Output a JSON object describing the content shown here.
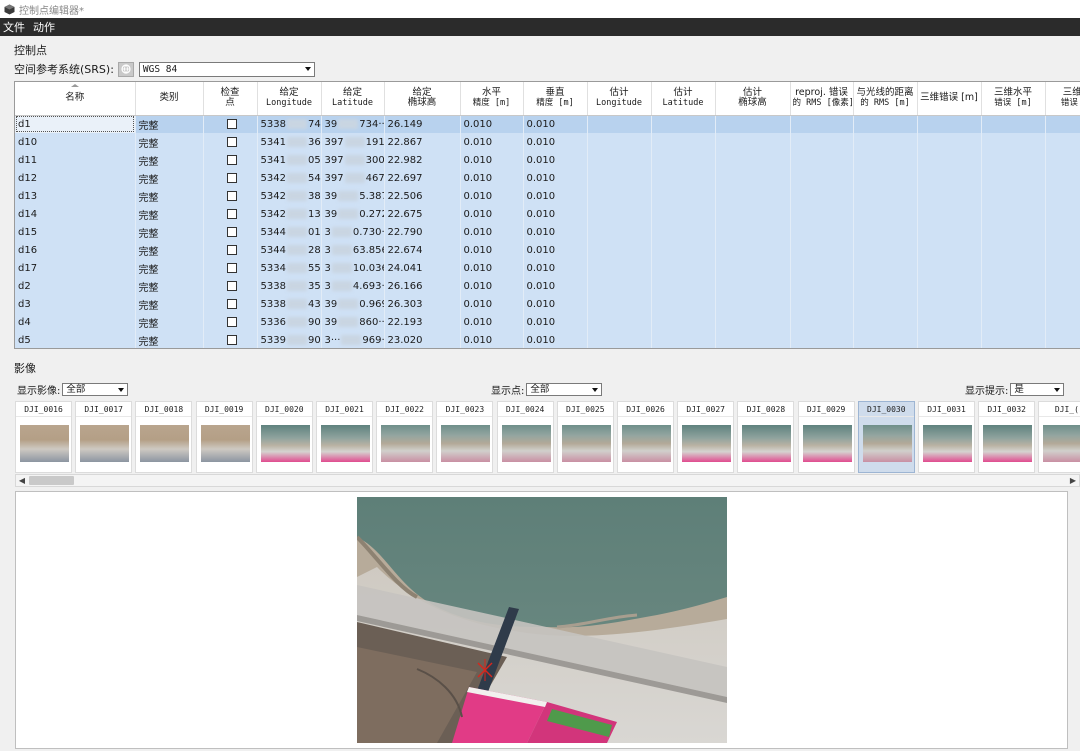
{
  "window": {
    "title": "控制点编辑器*"
  },
  "menu": {
    "items": [
      "文件",
      "动作"
    ]
  },
  "control_points": {
    "section_label": "控制点",
    "srs_label": "空间参考系统(SRS):",
    "srs_value": "WGS 84",
    "columns": [
      {
        "l1": "名称",
        "l2": ""
      },
      {
        "l1": "类别",
        "l2": ""
      },
      {
        "l1": "检查",
        "l2": "点"
      },
      {
        "l1": "给定",
        "l2": "Longitude"
      },
      {
        "l1": "给定",
        "l2": "Latitude"
      },
      {
        "l1": "给定",
        "l2": "椭球高"
      },
      {
        "l1": "水平",
        "l2": "精度 [m]"
      },
      {
        "l1": "垂直",
        "l2": "精度 [m]"
      },
      {
        "l1": "估计",
        "l2": "Longitude"
      },
      {
        "l1": "估计",
        "l2": "Latitude"
      },
      {
        "l1": "估计",
        "l2": "椭球高"
      },
      {
        "l1": "reproj. 错误",
        "l2": "的 RMS [像素]"
      },
      {
        "l1": "与光线的距离",
        "l2": "的 RMS [m]"
      },
      {
        "l1": "三维错误 [m]",
        "l2": ""
      },
      {
        "l1": "三维水平",
        "l2": "错误 [m]"
      },
      {
        "l1": "三维垂",
        "l2": "错误 [m"
      }
    ],
    "rows": [
      {
        "name": "d1",
        "type": "完整",
        "lon_a": "5338",
        "lon_b": "740···",
        "lat_a": "39",
        "lat_b": "734···",
        "height": "26.149",
        "h_acc": "0.010",
        "v_acc": "0.010"
      },
      {
        "name": "d10",
        "type": "完整",
        "lon_a": "5341",
        "lon_b": "360···",
        "lat_a": "397",
        "lat_b": "191···",
        "height": "22.867",
        "h_acc": "0.010",
        "v_acc": "0.010"
      },
      {
        "name": "d11",
        "type": "完整",
        "lon_a": "5341",
        "lon_b": "050···",
        "lat_a": "397",
        "lat_b": "300···",
        "height": "22.982",
        "h_acc": "0.010",
        "v_acc": "0.010"
      },
      {
        "name": "d12",
        "type": "完整",
        "lon_a": "5342",
        "lon_b": "540···",
        "lat_a": "397",
        "lat_b": "467···",
        "height": "22.697",
        "h_acc": "0.010",
        "v_acc": "0.010"
      },
      {
        "name": "d13",
        "type": "完整",
        "lon_a": "5342",
        "lon_b": "380···",
        "lat_a": "39",
        "lat_b": "5.387···",
        "height": "22.506",
        "h_acc": "0.010",
        "v_acc": "0.010"
      },
      {
        "name": "d14",
        "type": "完整",
        "lon_a": "5342",
        "lon_b": "130···",
        "lat_a": "39",
        "lat_b": "0.272···",
        "height": "22.675",
        "h_acc": "0.010",
        "v_acc": "0.010"
      },
      {
        "name": "d15",
        "type": "完整",
        "lon_a": "5344",
        "lon_b": "010···",
        "lat_a": "3",
        "lat_b": "0.730···",
        "height": "22.790",
        "h_acc": "0.010",
        "v_acc": "0.010"
      },
      {
        "name": "d16",
        "type": "完整",
        "lon_a": "5344",
        "lon_b": "280···",
        "lat_a": "3",
        "lat_b": "63.856···",
        "height": "22.674",
        "h_acc": "0.010",
        "v_acc": "0.010"
      },
      {
        "name": "d17",
        "type": "完整",
        "lon_a": "5334",
        "lon_b": "550···",
        "lat_a": "3",
        "lat_b": "10.036···",
        "height": "24.041",
        "h_acc": "0.010",
        "v_acc": "0.010"
      },
      {
        "name": "d2",
        "type": "完整",
        "lon_a": "5338",
        "lon_b": "350···",
        "lat_a": "3",
        "lat_b": "4.693···",
        "height": "26.166",
        "h_acc": "0.010",
        "v_acc": "0.010"
      },
      {
        "name": "d3",
        "type": "完整",
        "lon_a": "5338",
        "lon_b": "430···",
        "lat_a": "39",
        "lat_b": "0.969···",
        "height": "26.303",
        "h_acc": "0.010",
        "v_acc": "0.010"
      },
      {
        "name": "d4",
        "type": "完整",
        "lon_a": "5336",
        "lon_b": "900···",
        "lat_a": "39",
        "lat_b": "860···",
        "height": "22.193",
        "h_acc": "0.010",
        "v_acc": "0.010"
      },
      {
        "name": "d5",
        "type": "完整",
        "lon_a": "5339",
        "lon_b": "900···",
        "lat_a": "3···",
        "lat_b": "969···",
        "height": "23.020",
        "h_acc": "0.010",
        "v_acc": "0.010"
      }
    ]
  },
  "imagery": {
    "section_label": "影像",
    "show_images_label": "显示影像:",
    "show_images_value": "全部",
    "show_points_label": "显示点:",
    "show_points_value": "全部",
    "show_hints_label": "显示提示:",
    "show_hints_value": "是",
    "thumbnails": [
      "DJI_0016",
      "DJI_0017",
      "DJI_0018",
      "DJI_0019",
      "DJI_0020",
      "DJI_0021",
      "DJI_0022",
      "DJI_0023",
      "DJI_0024",
      "DJI_0025",
      "DJI_0026",
      "DJI_0027",
      "DJI_0028",
      "DJI_0029",
      "DJI_0030",
      "DJI_0031",
      "DJI_0032",
      "DJI_("
    ],
    "selected_thumbnail": "DJI_0030"
  },
  "colors": {
    "menubar": "#2b2b2b",
    "table_bg": "#cfe1f5",
    "row_selected": "#b8d2ee",
    "marker": "#d9261c"
  }
}
